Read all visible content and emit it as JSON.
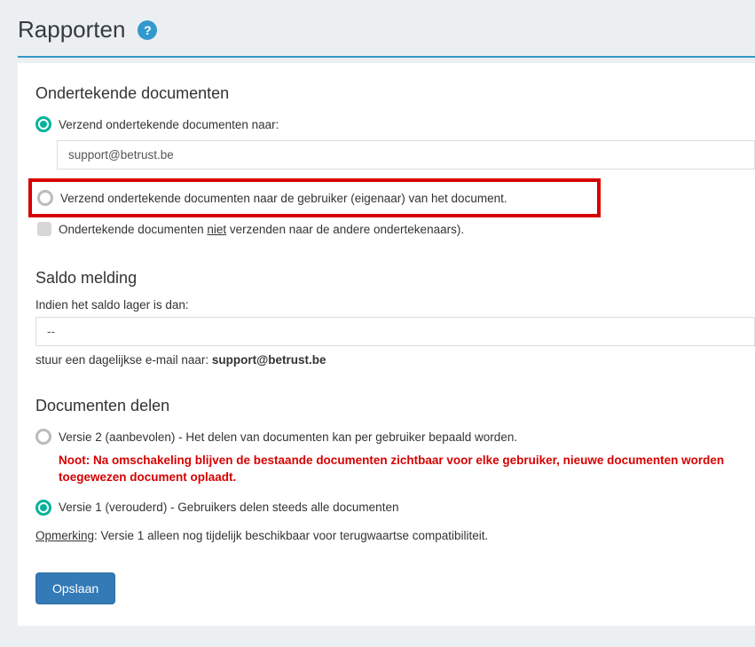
{
  "page": {
    "title": "Rapporten",
    "help_symbol": "?"
  },
  "signed_docs": {
    "heading": "Ondertekende documenten",
    "radio1_label": "Verzend ondertekende documenten naar:",
    "email_value": "support@betrust.be",
    "radio2_label": "Verzend ondertekende documenten naar de gebruiker (eigenaar) van het document.",
    "checkbox_pre": "Ondertekende documenten ",
    "checkbox_underlined": "niet",
    "checkbox_post": " verzenden naar de andere ondertekenaars)."
  },
  "balance": {
    "heading": "Saldo melding",
    "label": "Indien het saldo lager is dan:",
    "select_value": "--",
    "hint_pre": "stuur een dagelijkse e-mail naar: ",
    "hint_bold": "support@betrust.be"
  },
  "sharing": {
    "heading": "Documenten delen",
    "radio1_label": "Versie 2 (aanbevolen) - Het delen van documenten kan per gebruiker bepaald worden.",
    "note": "Noot: Na omschakeling blijven de bestaande documenten zichtbaar voor elke gebruiker, nieuwe documenten worden toegewezen document oplaadt.",
    "radio2_label": "Versie 1 (verouderd) - Gebruikers delen steeds alle documenten",
    "remark_underlined": "Opmerking",
    "remark_post": ": Versie 1 alleen nog tijdelijk beschikbaar voor terugwaartse compatibiliteit."
  },
  "actions": {
    "save_label": "Opslaan"
  }
}
